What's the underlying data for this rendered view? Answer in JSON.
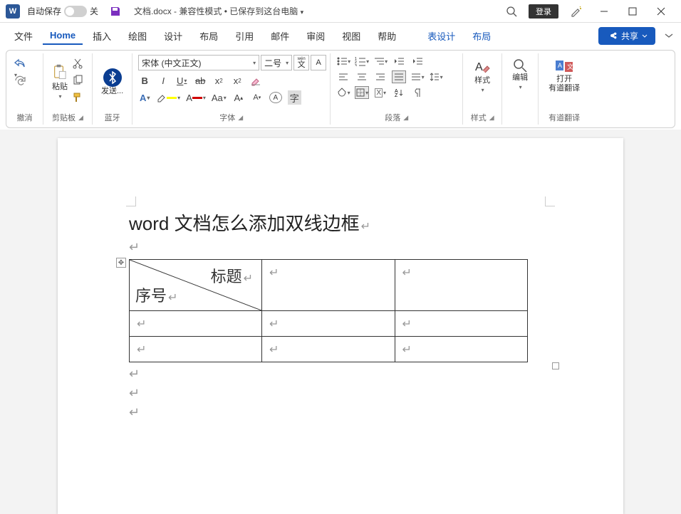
{
  "titlebar": {
    "autosave_label": "自动保存",
    "autosave_state": "关",
    "doc_name": "文档.docx",
    "mode": "兼容性模式",
    "saved": "已保存到这台电脑",
    "login": "登录"
  },
  "tabs": {
    "items": [
      "文件",
      "Home",
      "插入",
      "绘图",
      "设计",
      "布局",
      "引用",
      "邮件",
      "审阅",
      "视图",
      "帮助"
    ],
    "active_index": 1,
    "context": [
      "表设计",
      "布局"
    ],
    "share": "共享"
  },
  "ribbon": {
    "undo_group": "撤消",
    "clipboard": {
      "label": "剪贴板",
      "paste": "粘贴"
    },
    "bluetooth": {
      "label": "蓝牙",
      "send": "发送..."
    },
    "font": {
      "label": "字体",
      "name": "宋体 (中文正文)",
      "size": "二号",
      "wen": "wén",
      "bold": "B",
      "italic": "I",
      "underline": "U",
      "strike": "ab",
      "sub": "x",
      "sup": "x"
    },
    "paragraph": {
      "label": "段落"
    },
    "styles": {
      "label": "样式",
      "btn": "样式"
    },
    "editing": {
      "label": "",
      "btn": "编辑"
    },
    "youdao": {
      "label": "有道翻译",
      "open": "打开",
      "line2": "有道翻译"
    }
  },
  "document": {
    "heading": "word 文档怎么添加双线边框",
    "cell_title": "标题",
    "cell_serial": "序号"
  }
}
